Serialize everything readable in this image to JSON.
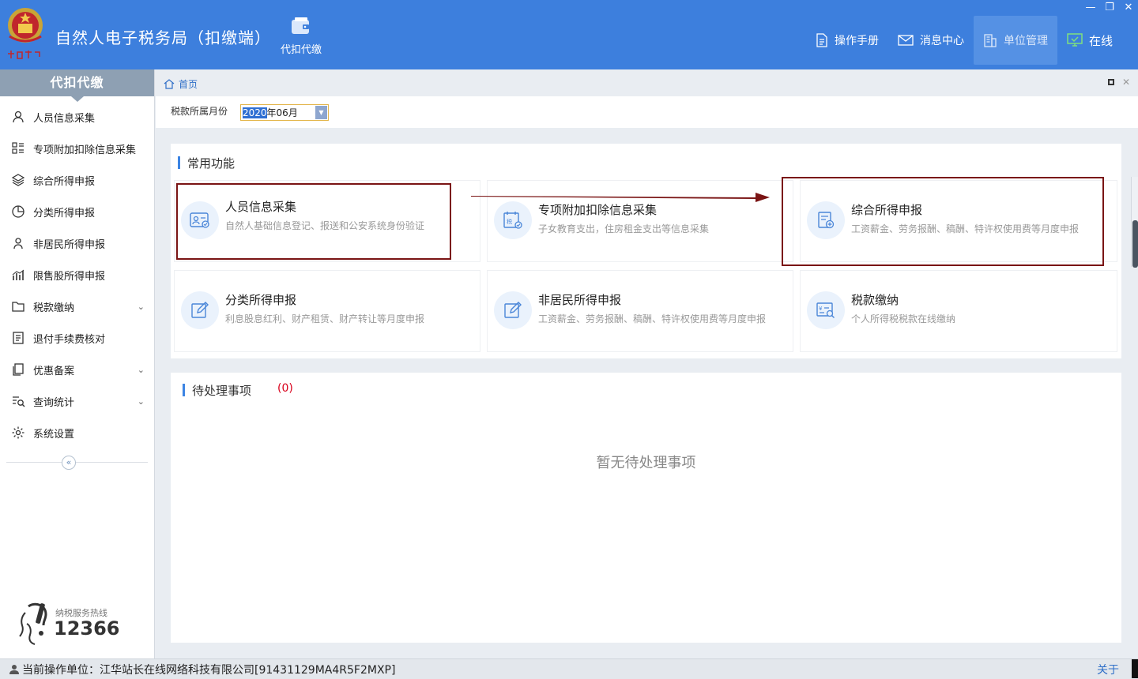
{
  "app": {
    "title": "自然人电子税务局（扣缴端）",
    "module_label": "代扣代缴",
    "nav": {
      "manual": "操作手册",
      "messages": "消息中心",
      "unit_mgmt": "单位管理",
      "online": "在线"
    },
    "window_controls": [
      "—",
      "❐",
      "✕"
    ]
  },
  "sidebar": {
    "header": "代扣代缴",
    "items": [
      {
        "label": "人员信息采集",
        "icon": "person-icon"
      },
      {
        "label": "专项附加扣除信息采集",
        "icon": "list-grid-icon"
      },
      {
        "label": "综合所得申报",
        "icon": "layers-icon"
      },
      {
        "label": "分类所得申报",
        "icon": "pie-chart-icon"
      },
      {
        "label": "非居民所得申报",
        "icon": "user-outline-icon"
      },
      {
        "label": "限售股所得申报",
        "icon": "bar-chart-icon"
      },
      {
        "label": "税款缴纳",
        "icon": "folder-icon",
        "expandable": true
      },
      {
        "label": "退付手续费核对",
        "icon": "document-icon"
      },
      {
        "label": "优惠备案",
        "icon": "copy-icon",
        "expandable": true
      },
      {
        "label": "查询统计",
        "icon": "search-list-icon",
        "expandable": true
      },
      {
        "label": "系统设置",
        "icon": "gear-icon"
      }
    ],
    "collapse_glyph": "«",
    "hotline_label": "纳税服务热线",
    "hotline_number": "12366"
  },
  "breadcrumb": {
    "home": "首页"
  },
  "filter": {
    "label": "税款所属月份",
    "year": "2020",
    "month_suffix": "年06月"
  },
  "common_functions": {
    "title": "常用功能",
    "cards": [
      {
        "title": "人员信息采集",
        "desc": "自然人基础信息登记、报送和公安系统身份验证",
        "icon": "id-card-icon"
      },
      {
        "title": "专项附加扣除信息采集",
        "desc": "子女教育支出，住房租金支出等信息采集",
        "icon": "tax-calendar-icon"
      },
      {
        "title": "综合所得申报",
        "desc": "工资薪金、劳务报酬、稿酬、特许权使用费等月度申报",
        "icon": "form-add-icon"
      },
      {
        "title": "分类所得申报",
        "desc": "利息股息红利、财产租赁、财产转让等月度申报",
        "icon": "edit-icon"
      },
      {
        "title": "非居民所得申报",
        "desc": "工资薪金、劳务报酬、稿酬、特许权使用费等月度申报",
        "icon": "edit-icon"
      },
      {
        "title": "税款缴纳",
        "desc": "个人所得税税款在线缴纳",
        "icon": "yuan-search-icon"
      }
    ]
  },
  "pending": {
    "title": "待处理事项",
    "count": "(0)",
    "empty_text": "暂无待处理事项"
  },
  "status_bar": {
    "current_unit": "当前操作单位：江华站长在线网络科技有限公司[91431129MA4R5F2MXP]",
    "about": "关于"
  },
  "colors": {
    "header_bg": "#3d7fdd",
    "accent": "#3c84e3",
    "highlight_box": "#7a1414",
    "pending_count": "#d9001b"
  }
}
